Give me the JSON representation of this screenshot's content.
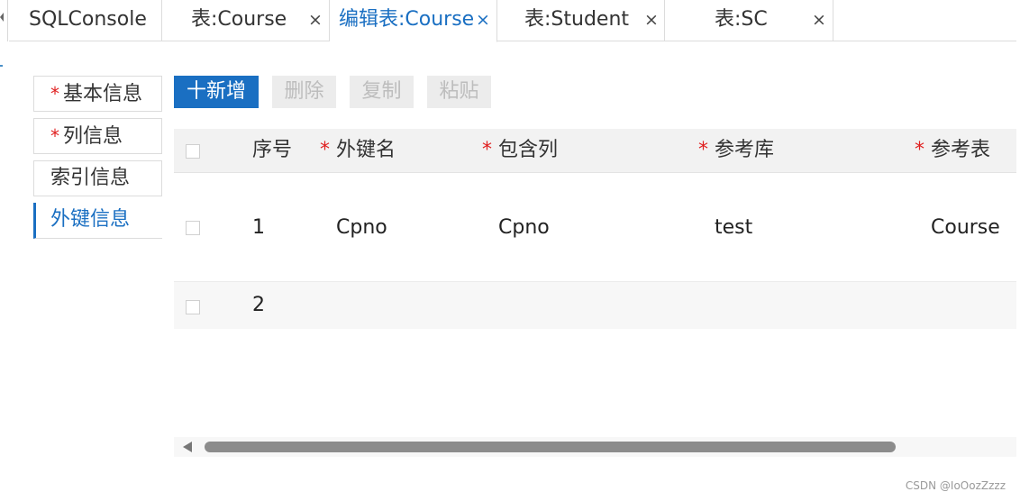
{
  "tabs": [
    {
      "label": "SQLConsole",
      "closable": false,
      "active": false
    },
    {
      "label": "表:Course",
      "closable": true,
      "active": false
    },
    {
      "label": "编辑表:Course",
      "closable": true,
      "active": true
    },
    {
      "label": "表:Student",
      "closable": true,
      "active": false
    },
    {
      "label": "表:SC",
      "closable": true,
      "active": false
    }
  ],
  "close_glyph": "×",
  "sidenav": {
    "items": [
      {
        "label": "基本信息",
        "required": true,
        "active": false
      },
      {
        "label": "列信息",
        "required": true,
        "active": false
      },
      {
        "label": "索引信息",
        "required": false,
        "active": false
      },
      {
        "label": "外键信息",
        "required": false,
        "active": true
      }
    ]
  },
  "toolbar": {
    "add_label": "十新增",
    "delete_label": "删除",
    "copy_label": "复制",
    "paste_label": "粘贴"
  },
  "table": {
    "required_mark": "*",
    "columns": [
      {
        "label": "序号",
        "required": false
      },
      {
        "label": "外键名",
        "required": true
      },
      {
        "label": "包含列",
        "required": true
      },
      {
        "label": "参考库",
        "required": true
      },
      {
        "label": "参考表",
        "required": true
      }
    ],
    "rows": [
      {
        "index": "1",
        "fk_name": "Cpno",
        "columns": "Cpno",
        "ref_db": "test",
        "ref_table": "Course"
      },
      {
        "index": "2",
        "fk_name": "",
        "columns": "",
        "ref_db": "",
        "ref_table": ""
      }
    ]
  },
  "watermark": "CSDN @IoOozZzzz",
  "colors": {
    "accent": "#1a6fc2",
    "required": "#e02020",
    "disabled_bg": "#ececec"
  }
}
